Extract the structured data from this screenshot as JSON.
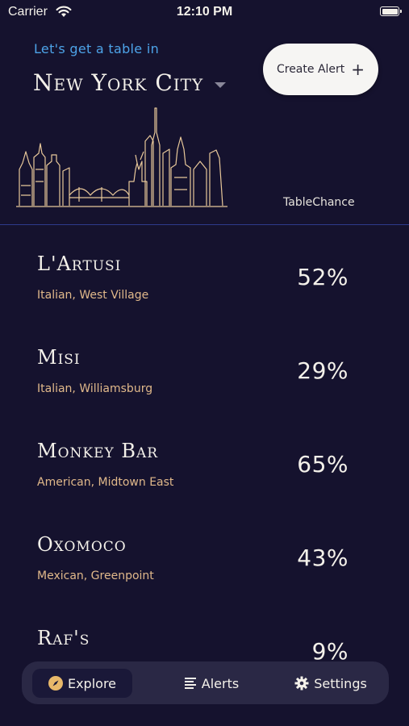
{
  "status": {
    "carrier": "Carrier",
    "time": "12:10 PM"
  },
  "header": {
    "tagline": "Let's get a table in",
    "city": "New York City",
    "create_alert_label": "Create Alert",
    "column_label": "TableChance"
  },
  "restaurants": [
    {
      "name": "L'Artusi",
      "details": "Italian, West Village",
      "chance": "52%"
    },
    {
      "name": "Misi",
      "details": "Italian, Williamsburg",
      "chance": "29%"
    },
    {
      "name": "Monkey Bar",
      "details": "American, Midtown East",
      "chance": "65%"
    },
    {
      "name": "Oxomoco",
      "details": "Mexican, Greenpoint",
      "chance": "43%"
    },
    {
      "name": "Raf's",
      "details": "",
      "chance": "9%"
    }
  ],
  "tabbar": {
    "explore": "Explore",
    "alerts": "Alerts",
    "settings": "Settings"
  },
  "colors": {
    "background": "#15122e",
    "accent_blue": "#4da3e8",
    "subtitle_gold": "#e0b88a",
    "skyline_stroke": "#e8c89a",
    "divider": "#2e3a8c"
  },
  "icons": [
    "wifi-icon",
    "battery-icon",
    "chevron-down-icon",
    "plus-icon",
    "skyline-illustration",
    "compass-icon",
    "list-icon",
    "gear-icon"
  ]
}
